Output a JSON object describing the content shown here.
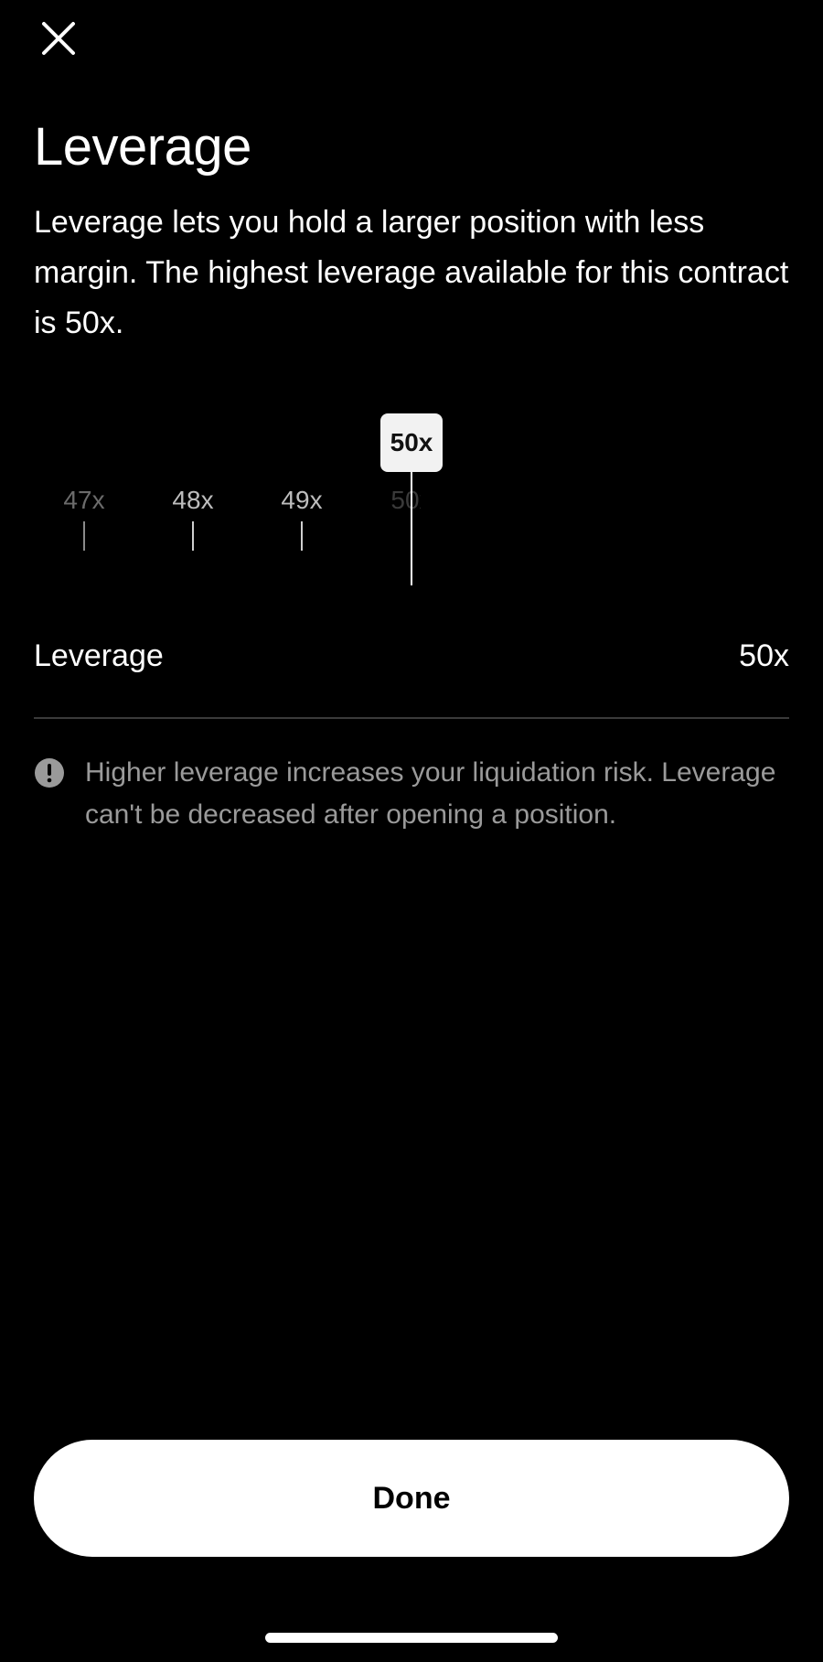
{
  "header": {
    "close_icon": "close-icon",
    "title": "Leverage",
    "description": "Leverage lets you hold a larger position with less margin. The highest leverage available for this contract is 50x."
  },
  "picker": {
    "ticks": [
      "47x",
      "48x",
      "49x",
      "50x"
    ],
    "selected_label": "50x",
    "selected_value": 50,
    "max_value": 50
  },
  "summary": {
    "label": "Leverage",
    "value": "50x"
  },
  "warning": {
    "icon": "exclamation-circle-icon",
    "text": "Higher leverage increases your liquidation risk. Leverage can't be decreased after opening a position."
  },
  "footer": {
    "done_label": "Done"
  },
  "colors": {
    "background": "#000000",
    "text_primary": "#ffffff",
    "text_secondary": "#9a9a9a",
    "button_bg": "#ffffff",
    "button_text": "#000000"
  }
}
